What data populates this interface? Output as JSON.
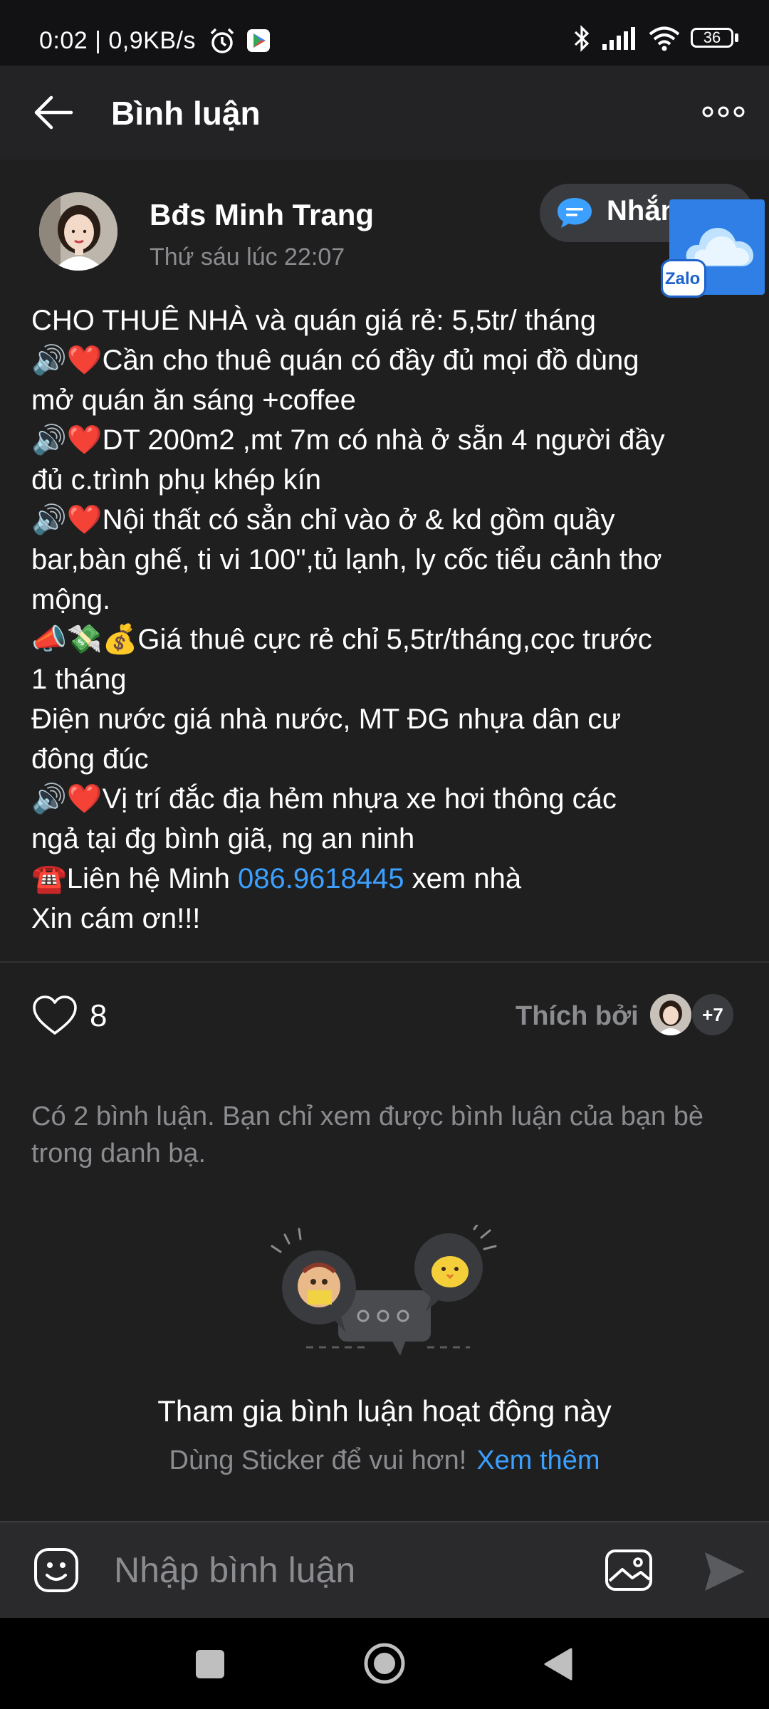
{
  "status_bar": {
    "time_speed": "0:02 | 0,9KB/s",
    "battery": "36",
    "icons": [
      "alarm-icon",
      "play-store-icon",
      "bluetooth-icon",
      "signal-icon",
      "wifi-icon",
      "battery-icon"
    ]
  },
  "header": {
    "title": "Bình luận",
    "back_icon": "back-arrow-icon",
    "more_icon": "more-options-icon"
  },
  "post": {
    "author": "Bđs Minh Trang",
    "time": "Thứ sáu lúc 22:07",
    "message_button_label": "Nhắn",
    "lines": [
      "CHO THUÊ NHÀ và quán giá rẻ: 5,5tr/ tháng",
      "🔊❤️Cần cho thuê quán có đầy đủ mọi đồ dùng",
      "mở quán ăn sáng +coffee",
      "🔊❤️DT 200m2 ,mt 7m có nhà ở sẵn 4 người đầy",
      "đủ c.trình phụ khép kín",
      "🔊❤️Nội thất có sẳn chỉ vào ở & kd gồm quầy",
      "bar,bàn ghế, ti vi 100\",tủ lạnh, ly cốc tiểu cảnh thơ",
      "mộng.",
      "📣💸💰Giá thuê cực rẻ chỉ 5,5tr/tháng,cọc trước",
      "1 tháng",
      "Điện nước giá nhà nước, MT ĐG nhựa dân cư",
      "đông đúc",
      "🔊❤️Vị trí đắc địa hẻm nhựa xe hơi thông các",
      "ngả tại đg bình giã, ng an ninh"
    ],
    "contact_prefix": "☎️Liên hệ Minh ",
    "contact_phone": "086.9618445",
    "contact_suffix": " xem nhà",
    "closing": "Xin cám ơn!!!"
  },
  "likes": {
    "count": "8",
    "liked_by_label": "Thích bởi",
    "more_count": "+7"
  },
  "comments": {
    "notice": "Có 2 bình luận. Bạn chỉ xem được bình luận của bạn bè trong danh bạ.",
    "join_title": "Tham gia bình luận hoạt động này",
    "sticker_hint": "Dùng Sticker để vui hơn!",
    "see_more": "Xem thêm"
  },
  "input": {
    "placeholder": "Nhập bình luận"
  },
  "zalo_badge": "Zalo",
  "colors": {
    "background": "#1f1f20",
    "header": "#232325",
    "link": "#3ba0ff",
    "muted": "#8b8c8f"
  }
}
